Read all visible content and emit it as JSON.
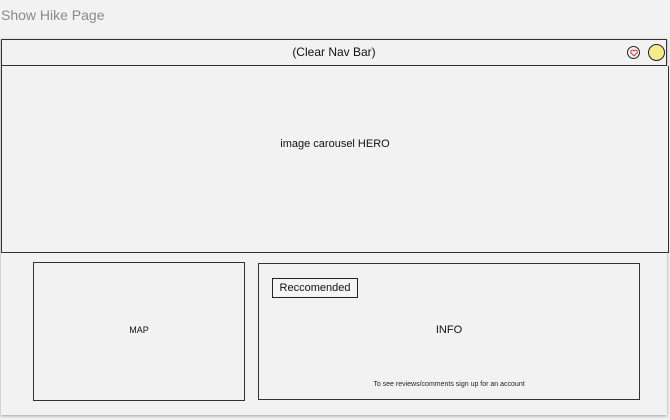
{
  "page": {
    "title": "Show Hike Page"
  },
  "navbar": {
    "label": "(Clear Nav Bar)",
    "icons": [
      "heart-icon",
      "user-avatar-icon"
    ]
  },
  "hero": {
    "label": "image carousel HERO"
  },
  "map": {
    "label": "MAP"
  },
  "info": {
    "label": "INFO",
    "recommended_label": "Reccomended",
    "note": "To see reviews/comments sign up for an account"
  },
  "colors": {
    "background": "#f2f2f2",
    "border": "#333333",
    "title_gray": "#8a8a8a",
    "avatar_yellow": "#f7ea8b",
    "heart_red": "#d23c3c"
  }
}
